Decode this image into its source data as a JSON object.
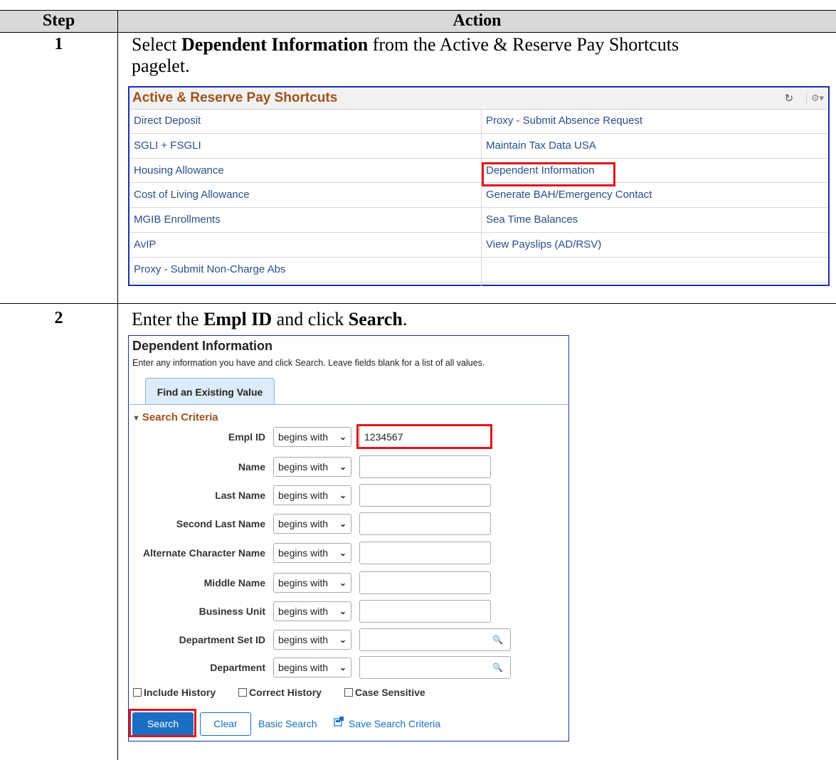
{
  "table": {
    "header_step": "Step",
    "header_action": "Action"
  },
  "step1": {
    "number": "1",
    "instruction_parts": [
      "Select ",
      "Dependent Information",
      " from the Active & Reserve Pay Shortcuts",
      "pagelet."
    ],
    "pagelet": {
      "title": "Active & Reserve Pay Shortcuts",
      "left_links": [
        "Direct Deposit",
        "SGLI + FSGLI",
        "Housing Allowance",
        "Cost of Living Allowance",
        "MGIB Enrollments",
        "AvIP",
        "Proxy - Submit Non-Charge Abs"
      ],
      "right_links": [
        "Proxy - Submit Absence Request",
        "Maintain Tax Data USA",
        "Dependent Information",
        "Generate BAH/Emergency Contact",
        "Sea Time Balances",
        "View Payslips (AD/RSV)",
        ""
      ],
      "highlighted_link": "Dependent Information"
    }
  },
  "step2": {
    "number": "2",
    "instruction_parts": [
      "Enter the ",
      "Empl ID",
      " and click ",
      "Search",
      "."
    ],
    "panel": {
      "title": "Dependent Information",
      "subtitle": "Enter any information you have and click Search. Leave fields blank for a list of all values.",
      "tab": "Find an Existing Value",
      "criteria_heading": "Search Criteria",
      "operator_default": "begins with",
      "fields": [
        {
          "label": "Empl ID",
          "value": "1234567"
        },
        {
          "label": "Name",
          "value": ""
        },
        {
          "label": "Last Name",
          "value": ""
        },
        {
          "label": "Second Last Name",
          "value": ""
        },
        {
          "label": "Alternate Character Name",
          "value": ""
        },
        {
          "label": "Middle Name",
          "value": ""
        },
        {
          "label": "Business Unit",
          "value": ""
        },
        {
          "label": "Department Set ID",
          "value": ""
        },
        {
          "label": "Department",
          "value": ""
        }
      ],
      "checkboxes": [
        "Include History",
        "Correct History",
        "Case Sensitive"
      ],
      "buttons": {
        "search": "Search",
        "clear": "Clear"
      },
      "links": {
        "basic_search": "Basic Search",
        "save_criteria": "Save Search Criteria"
      }
    }
  },
  "colors": {
    "pagelet_title": "#a0521c",
    "link": "#2b4e8a",
    "primary_button": "#1a6fc4",
    "highlight_box": "#e0161b",
    "panel_border": "#1b2fb3"
  }
}
